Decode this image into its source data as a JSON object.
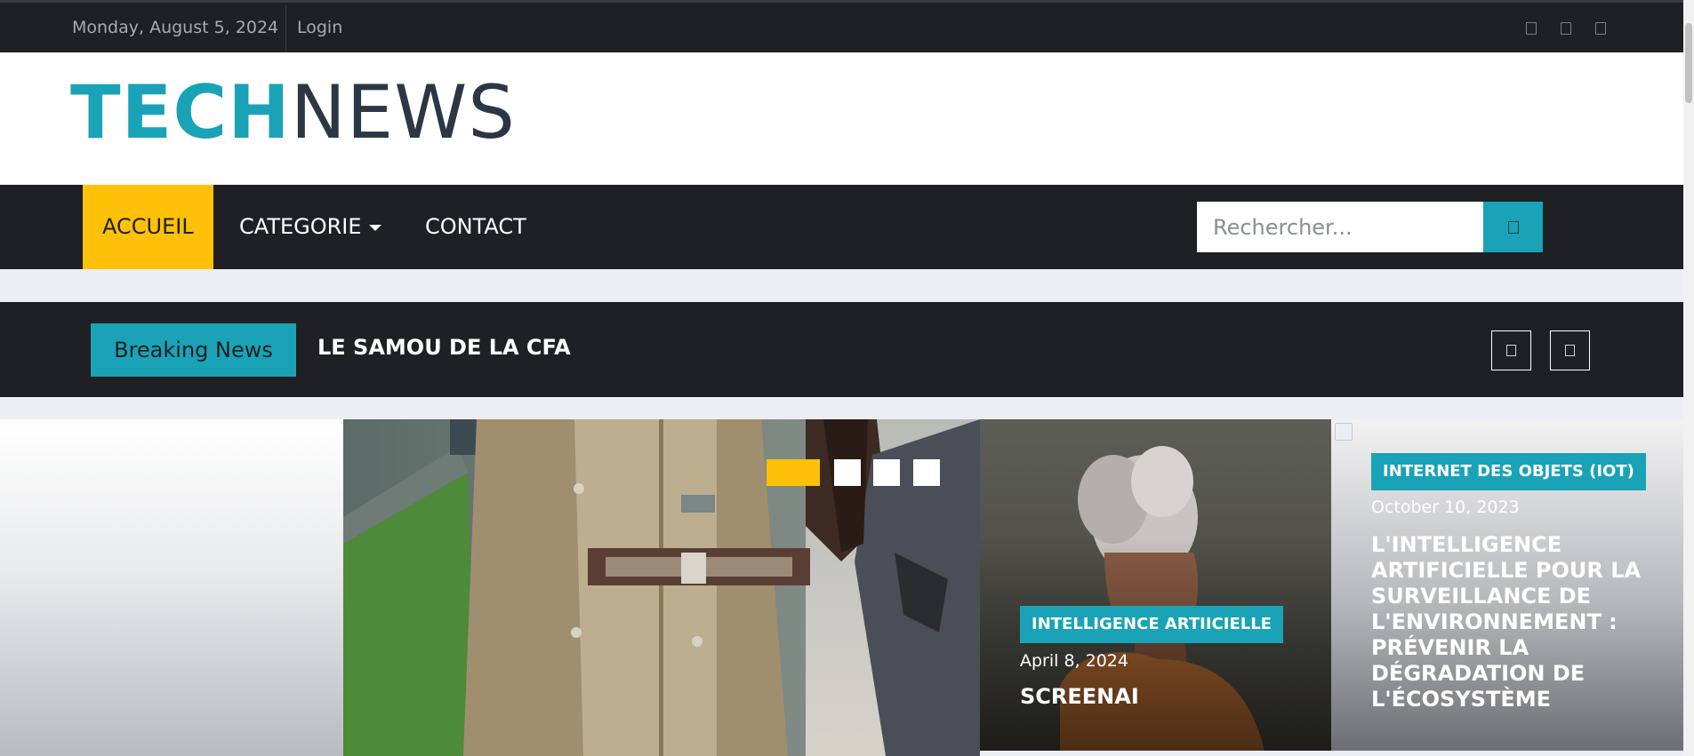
{
  "topbar": {
    "date": "Monday, August 5, 2024",
    "login": "Login",
    "social_icons": [
      "facebook-icon",
      "twitter-icon",
      "linkedin-icon"
    ]
  },
  "logo": {
    "part1": "TECH",
    "part2": "NEWS"
  },
  "nav": {
    "items": [
      {
        "label": "ACCUEIL",
        "active": true
      },
      {
        "label": "CATEGORIE",
        "dropdown": true
      },
      {
        "label": "CONTACT"
      }
    ],
    "search_placeholder": "Rechercher...",
    "search_icon": "search-icon"
  },
  "breaking": {
    "label": "Breaking News",
    "headline": "LE SAMOU DE LA CFA",
    "controls": [
      "chevron-left-icon",
      "chevron-right-icon"
    ]
  },
  "slider": {
    "slide_count": 4,
    "active_index": 0
  },
  "cards": [
    {
      "category": "INTELLIGENCE ARTIICIELLE",
      "date": "April 8, 2024",
      "title": "SCREENAI"
    },
    {
      "category": "INTERNET DES OBJETS (IOT)",
      "date": "October 10, 2023",
      "title": "L'INTELLIGENCE ARTIFICIELLE POUR LA SURVEILLANCE DE L'ENVIRONNEMENT : PRÉVENIR LA DÉGRADATION DE L'ÉCOSYSTÈME"
    }
  ],
  "colors": {
    "accent": "#1aa2b6",
    "highlight": "#ffc107",
    "dark": "#1e2024",
    "logo_dark": "#2c3744"
  }
}
